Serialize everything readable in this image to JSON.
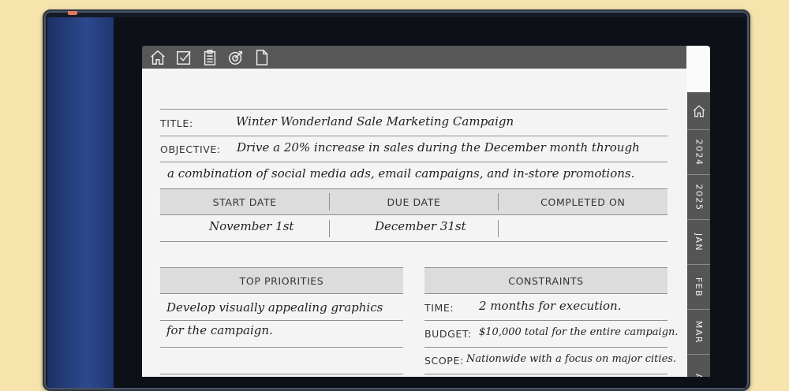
{
  "toolbar": {
    "icons": [
      "home-icon",
      "checkbox-icon",
      "clipboard-icon",
      "goal-icon",
      "document-icon"
    ]
  },
  "side_tabs": {
    "items": [
      "2024",
      "2025",
      "JAN",
      "FEB",
      "MAR",
      "A"
    ]
  },
  "form": {
    "title_label": "TITLE:",
    "title_value": "Winter Wonderland Sale Marketing Campaign",
    "objective_label": "OBJECTIVE:",
    "objective_line1": "Drive a 20% increase in sales during the December month through",
    "objective_line2": "a combination of social media ads, email campaigns, and in-store promotions.",
    "dates": {
      "start_label": "START DATE",
      "due_label": "DUE DATE",
      "completed_label": "COMPLETED ON",
      "start_value": "November 1st",
      "due_value": "December 31st",
      "completed_value": ""
    },
    "priorities": {
      "header": "TOP PRIORITIES",
      "line1": "Develop visually appealing graphics",
      "line2": "for the campaign."
    },
    "constraints": {
      "header": "CONSTRAINTS",
      "time_label": "TIME:",
      "time_value": "2 months for execution.",
      "budget_label": "BUDGET:",
      "budget_value": "$10,000 total for the entire campaign.",
      "scope_label": "SCOPE:",
      "scope_value": "Nationwide with a focus on major cities."
    }
  }
}
